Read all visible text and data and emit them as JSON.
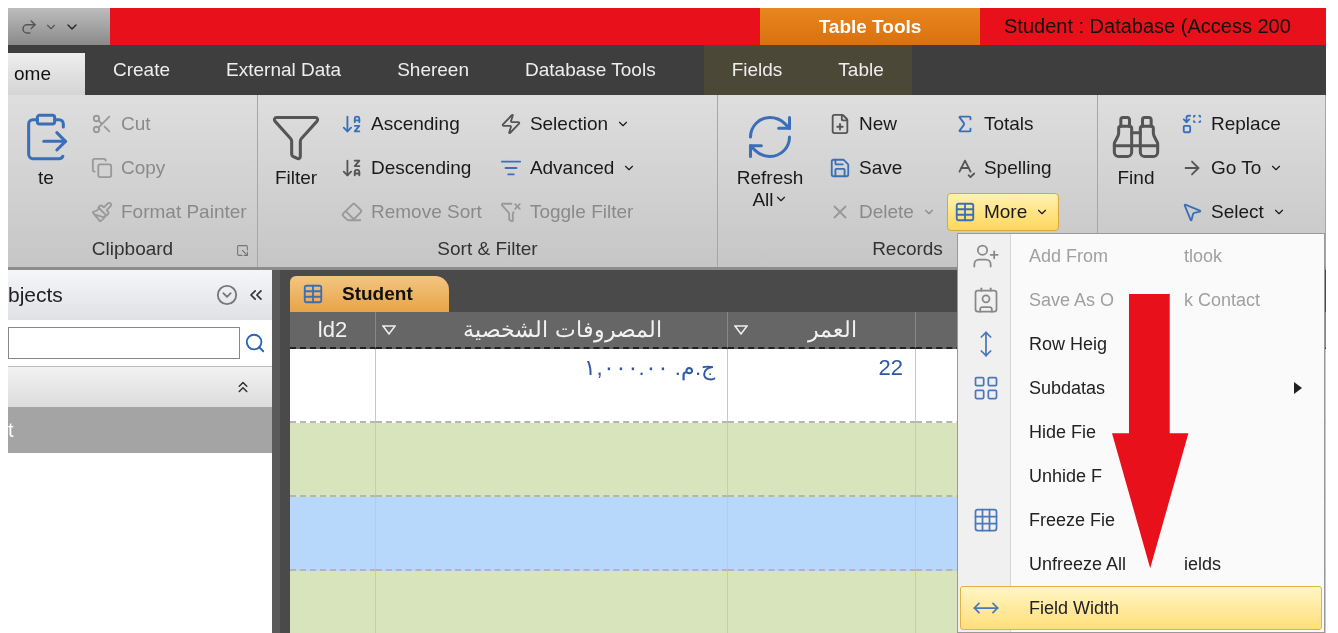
{
  "window": {
    "title": "Student : Database (Access 200",
    "contextual_tab_group": "Table Tools"
  },
  "tabs": [
    {
      "label": "ome",
      "selected": true,
      "contextual": false
    },
    {
      "label": "Create",
      "selected": false,
      "contextual": false
    },
    {
      "label": "External Data",
      "selected": false,
      "contextual": false
    },
    {
      "label": "Shereen",
      "selected": false,
      "contextual": false
    },
    {
      "label": "Database Tools",
      "selected": false,
      "contextual": false
    },
    {
      "label": "Fields",
      "selected": false,
      "contextual": true
    },
    {
      "label": "Table",
      "selected": false,
      "contextual": true
    }
  ],
  "ribbon": [
    {
      "label": "Clipboard",
      "launcher": true,
      "columns": [
        [
          {
            "kind": "large",
            "label": "te",
            "disabled": false,
            "dropdown": false,
            "selected": false
          }
        ],
        [
          {
            "kind": "small",
            "label": "Cut",
            "disabled": true,
            "dropdown": false,
            "selected": false
          },
          {
            "kind": "small",
            "label": "Copy",
            "disabled": true,
            "dropdown": false,
            "selected": false
          },
          {
            "kind": "small",
            "label": "Format Painter",
            "disabled": true,
            "dropdown": false,
            "selected": false
          }
        ]
      ]
    },
    {
      "label": "Sort & Filter",
      "columns": [
        [
          {
            "kind": "large",
            "label": "Filter",
            "disabled": false,
            "dropdown": false,
            "selected": false
          }
        ],
        [
          {
            "kind": "small",
            "label": "Ascending",
            "disabled": false,
            "dropdown": false,
            "selected": false
          },
          {
            "kind": "small",
            "label": "Descending",
            "disabled": false,
            "dropdown": false,
            "selected": false
          },
          {
            "kind": "small",
            "label": "Remove Sort",
            "disabled": true,
            "dropdown": false,
            "selected": false
          }
        ],
        [
          {
            "kind": "small",
            "label": "Selection",
            "disabled": false,
            "dropdown": true,
            "selected": false
          },
          {
            "kind": "small",
            "label": "Advanced",
            "disabled": false,
            "dropdown": true,
            "selected": false
          },
          {
            "kind": "small",
            "label": "Toggle Filter",
            "disabled": true,
            "dropdown": false,
            "selected": false
          }
        ]
      ]
    },
    {
      "label": "Records",
      "columns": [
        [
          {
            "kind": "large",
            "label": "Refresh All",
            "disabled": false,
            "dropdown": true,
            "selected": false
          }
        ],
        [
          {
            "kind": "small",
            "label": "New",
            "disabled": false,
            "dropdown": false,
            "selected": false
          },
          {
            "kind": "small",
            "label": "Save",
            "disabled": false,
            "dropdown": false,
            "selected": false
          },
          {
            "kind": "small",
            "label": "Delete",
            "disabled": true,
            "dropdown": true,
            "selected": false
          }
        ],
        [
          {
            "kind": "small",
            "label": "Totals",
            "disabled": false,
            "dropdown": false,
            "selected": false
          },
          {
            "kind": "small",
            "label": "Spelling",
            "disabled": false,
            "dropdown": false,
            "selected": false
          },
          {
            "kind": "small",
            "label": "More",
            "disabled": false,
            "dropdown": true,
            "selected": true
          }
        ]
      ]
    },
    {
      "columns": [
        [
          {
            "kind": "large",
            "label": "Find",
            "disabled": false,
            "dropdown": false,
            "selected": false
          }
        ],
        [
          {
            "kind": "small",
            "label": "Replace",
            "disabled": false,
            "dropdown": false,
            "selected": false
          },
          {
            "kind": "small",
            "label": "Go To",
            "disabled": false,
            "dropdown": true,
            "selected": false
          },
          {
            "kind": "small",
            "label": "Select",
            "disabled": false,
            "dropdown": true,
            "selected": false
          }
        ]
      ]
    }
  ],
  "navigation_pane": {
    "title": "bjects",
    "items": [
      {
        "label": "t",
        "selected": true
      }
    ]
  },
  "document_tab": {
    "label": "Student"
  },
  "table": {
    "columns": [
      "ld2",
      "المصروفات الشخصية",
      "العمر",
      ""
    ],
    "rows": [
      {
        "selected": false,
        "cells": [
          "",
          "ج.م. ١,٠٠٠.٠٠",
          "22",
          ""
        ]
      },
      {
        "selected": false,
        "cells": []
      },
      {
        "selected": true,
        "cells": []
      },
      {
        "selected": false,
        "cells": []
      }
    ]
  },
  "menu": [
    {
      "label": "Add From",
      "tail": "tlook",
      "disabled": true,
      "submenu": false,
      "selected": false
    },
    {
      "label": "Save As O",
      "tail": "k Contact",
      "disabled": true,
      "submenu": false,
      "selected": false
    },
    {
      "label": "Row Heig",
      "disabled": false,
      "submenu": false,
      "selected": false
    },
    {
      "label": "Subdatas",
      "disabled": false,
      "submenu": true,
      "selected": false
    },
    {
      "label": "Hide Fie",
      "disabled": false,
      "submenu": false,
      "selected": false
    },
    {
      "label": "Unhide F",
      "disabled": false,
      "submenu": false,
      "selected": false
    },
    {
      "label": "Freeze Fie",
      "disabled": false,
      "submenu": false,
      "selected": false
    },
    {
      "label": "Unfreeze All",
      "tail": "ields",
      "disabled": false,
      "submenu": false,
      "selected": false
    },
    {
      "label": "Field Width",
      "disabled": false,
      "submenu": false,
      "selected": true
    }
  ]
}
